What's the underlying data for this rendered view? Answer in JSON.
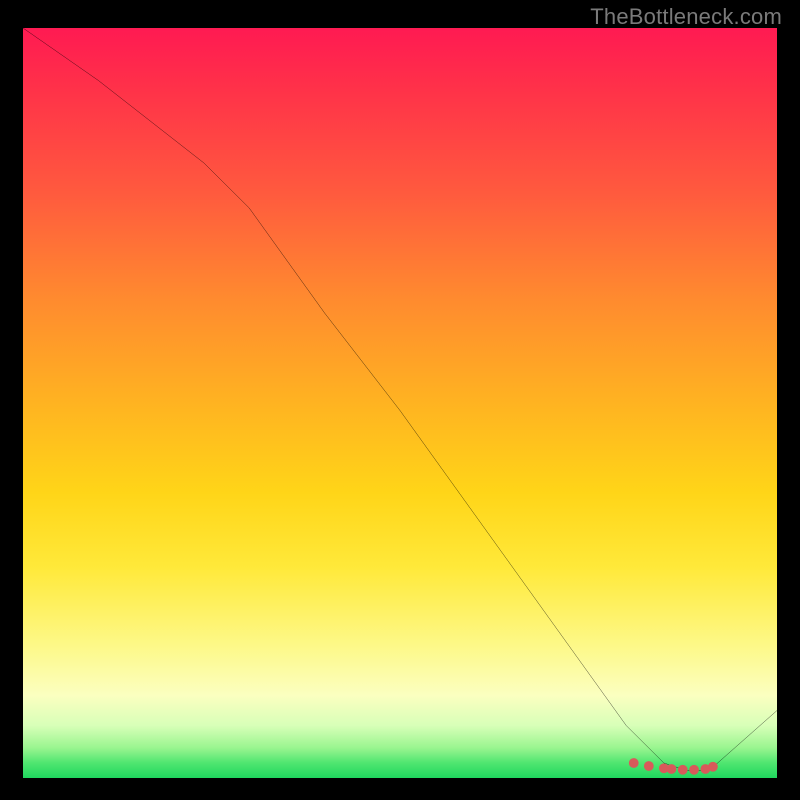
{
  "attribution": "TheBottleneck.com",
  "chart_data": {
    "type": "line",
    "title": "",
    "xlabel": "",
    "ylabel": "",
    "xlim": [
      0,
      100
    ],
    "ylim": [
      0,
      100
    ],
    "series": [
      {
        "name": "bottleneck-curve",
        "x": [
          0,
          10,
          24,
          30,
          40,
          50,
          60,
          70,
          80,
          85,
          88,
          91,
          100
        ],
        "y": [
          100,
          93,
          82,
          76,
          62,
          49,
          35,
          21,
          7,
          2,
          1,
          1,
          9
        ]
      }
    ],
    "markers": {
      "name": "optimal-range",
      "points": [
        {
          "x": 81,
          "y": 2.0
        },
        {
          "x": 83,
          "y": 1.6
        },
        {
          "x": 85,
          "y": 1.3
        },
        {
          "x": 86,
          "y": 1.2
        },
        {
          "x": 87.5,
          "y": 1.1
        },
        {
          "x": 89,
          "y": 1.1
        },
        {
          "x": 90.5,
          "y": 1.2
        },
        {
          "x": 91.5,
          "y": 1.5
        }
      ],
      "color": "#d85a5a"
    },
    "gradient_stops": [
      {
        "pos": 0,
        "color": "#ff1a52"
      },
      {
        "pos": 50,
        "color": "#ffb321"
      },
      {
        "pos": 82,
        "color": "#fdf885"
      },
      {
        "pos": 100,
        "color": "#1fd65e"
      }
    ]
  }
}
